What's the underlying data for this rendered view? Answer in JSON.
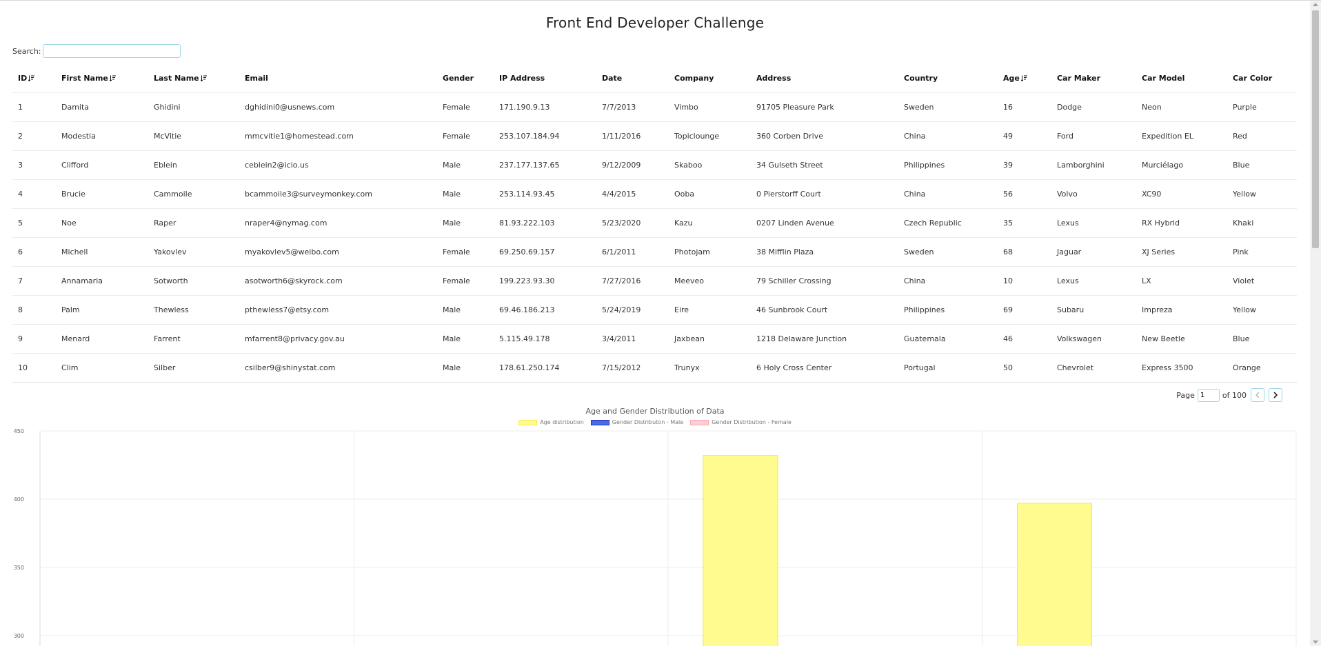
{
  "page": {
    "title": "Front End Developer Challenge"
  },
  "search": {
    "label": "Search:",
    "value": ""
  },
  "table": {
    "columns": [
      {
        "label": "ID",
        "sortable": true
      },
      {
        "label": "First Name",
        "sortable": true
      },
      {
        "label": "Last Name",
        "sortable": true
      },
      {
        "label": "Email",
        "sortable": false
      },
      {
        "label": "Gender",
        "sortable": false
      },
      {
        "label": "IP Address",
        "sortable": false
      },
      {
        "label": "Date",
        "sortable": false
      },
      {
        "label": "Company",
        "sortable": false
      },
      {
        "label": "Address",
        "sortable": false
      },
      {
        "label": "Country",
        "sortable": false
      },
      {
        "label": "Age",
        "sortable": true
      },
      {
        "label": "Car Maker",
        "sortable": false
      },
      {
        "label": "Car Model",
        "sortable": false
      },
      {
        "label": "Car Color",
        "sortable": false
      }
    ],
    "rows": [
      [
        "1",
        "Damita",
        "Ghidini",
        "dghidini0@usnews.com",
        "Female",
        "171.190.9.13",
        "7/7/2013",
        "Vimbo",
        "91705 Pleasure Park",
        "Sweden",
        "16",
        "Dodge",
        "Neon",
        "Purple"
      ],
      [
        "2",
        "Modestia",
        "McVitie",
        "mmcvitie1@homestead.com",
        "Female",
        "253.107.184.94",
        "1/11/2016",
        "Topiclounge",
        "360 Corben Drive",
        "China",
        "49",
        "Ford",
        "Expedition EL",
        "Red"
      ],
      [
        "3",
        "Clifford",
        "Eblein",
        "ceblein2@icio.us",
        "Male",
        "237.177.137.65",
        "9/12/2009",
        "Skaboo",
        "34 Gulseth Street",
        "Philippines",
        "39",
        "Lamborghini",
        "Murciélago",
        "Blue"
      ],
      [
        "4",
        "Brucie",
        "Cammoile",
        "bcammoile3@surveymonkey.com",
        "Male",
        "253.114.93.45",
        "4/4/2015",
        "Ooba",
        "0 Pierstorff Court",
        "China",
        "56",
        "Volvo",
        "XC90",
        "Yellow"
      ],
      [
        "5",
        "Noe",
        "Raper",
        "nraper4@nymag.com",
        "Male",
        "81.93.222.103",
        "5/23/2020",
        "Kazu",
        "0207 Linden Avenue",
        "Czech Republic",
        "35",
        "Lexus",
        "RX Hybrid",
        "Khaki"
      ],
      [
        "6",
        "Michell",
        "Yakovlev",
        "myakovlev5@weibo.com",
        "Female",
        "69.250.69.157",
        "6/1/2011",
        "Photojam",
        "38 Mifflin Plaza",
        "Sweden",
        "68",
        "Jaguar",
        "XJ Series",
        "Pink"
      ],
      [
        "7",
        "Annamaria",
        "Sotworth",
        "asotworth6@skyrock.com",
        "Female",
        "199.223.93.30",
        "7/27/2016",
        "Meeveo",
        "79 Schiller Crossing",
        "China",
        "10",
        "Lexus",
        "LX",
        "Violet"
      ],
      [
        "8",
        "Palm",
        "Thewless",
        "pthewless7@etsy.com",
        "Male",
        "69.46.186.213",
        "5/24/2019",
        "Eire",
        "46 Sunbrook Court",
        "Philippines",
        "69",
        "Subaru",
        "Impreza",
        "Yellow"
      ],
      [
        "9",
        "Menard",
        "Farrent",
        "mfarrent8@privacy.gov.au",
        "Male",
        "5.115.49.178",
        "3/4/2011",
        "Jaxbean",
        "1218 Delaware Junction",
        "Guatemala",
        "46",
        "Volkswagen",
        "New Beetle",
        "Blue"
      ],
      [
        "10",
        "Clim",
        "Silber",
        "csilber9@shinystat.com",
        "Male",
        "178.61.250.174",
        "7/15/2012",
        "Trunyx",
        "6 Holy Cross Center",
        "Portugal",
        "50",
        "Chevrolet",
        "Express 3500",
        "Orange"
      ]
    ]
  },
  "pagination": {
    "page_label": "Page",
    "current": "1",
    "of_label": "of 100"
  },
  "chart_data": {
    "type": "bar",
    "title": "Age and Gender Distribution of Data",
    "legend": [
      {
        "name": "Age distribution",
        "fill": "#fffb8f",
        "stroke": "#f3ea4a"
      },
      {
        "name": "Gender Distributon - Male",
        "fill": "#4b6be6",
        "stroke": "#1d2fb5"
      },
      {
        "name": "Gender Distribution - Female",
        "fill": "#ffcdd4",
        "stroke": "#f4a8b3"
      }
    ],
    "legend_position": "top",
    "categories": [
      "",
      "",
      "",
      ""
    ],
    "series": [
      {
        "name": "Age distribution",
        "values": [
          null,
          null,
          432,
          397
        ]
      }
    ],
    "yticks": [
      450,
      400,
      350,
      300
    ],
    "ylim_visible": [
      287,
      450
    ],
    "grid": true
  }
}
